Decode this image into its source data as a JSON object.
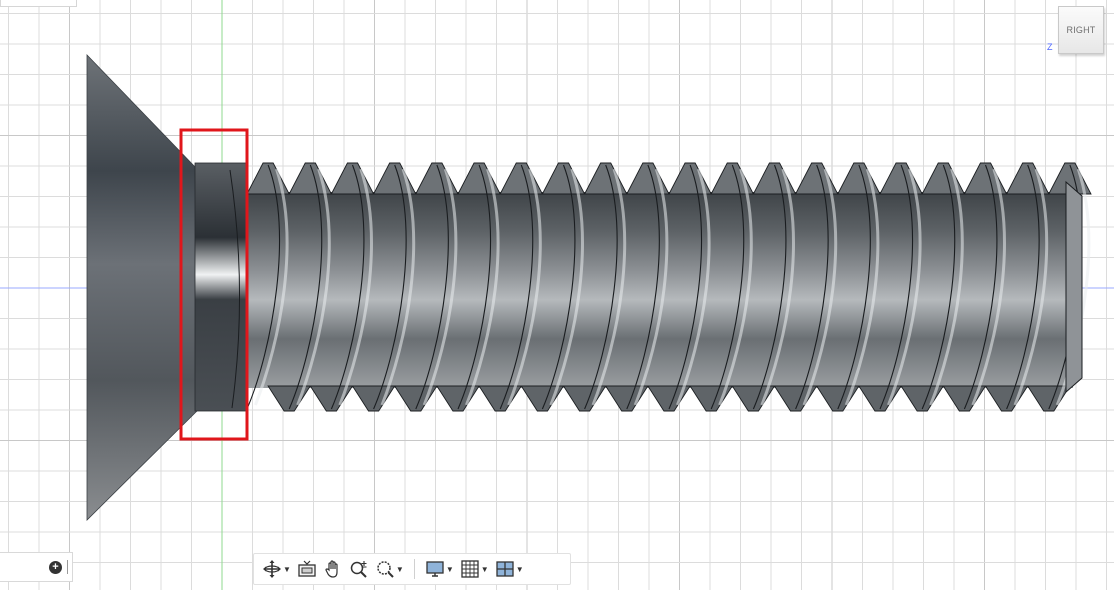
{
  "viewcube": {
    "face_label": "RIGHT",
    "axis_label": "Z"
  },
  "highlight": {
    "color": "#e0161b"
  },
  "colors": {
    "grid": "#dcdcdc",
    "grid_major": "#c8c8c8",
    "axis_green": "#8fd88f",
    "axis_blue": "#9aa8ff",
    "bolt_dark": "#2c3136",
    "bolt_light": "#e8eaec"
  },
  "browser_panel": {
    "icon": "plus-circle-icon"
  },
  "nav_toolbar": {
    "tools": [
      {
        "name": "orbit-tool",
        "icon": "orbit-icon",
        "has_menu": true
      },
      {
        "name": "look-at-tool",
        "icon": "look-at-icon",
        "has_menu": false
      },
      {
        "name": "pan-tool",
        "icon": "hand-icon",
        "has_menu": false
      },
      {
        "name": "zoom-tool",
        "icon": "zoom-plusminus-icon",
        "has_menu": false
      },
      {
        "name": "fit-tool",
        "icon": "zoom-window-icon",
        "has_menu": true
      },
      {
        "name": "display-settings",
        "icon": "monitor-icon",
        "has_menu": true
      },
      {
        "name": "grid-settings",
        "icon": "grid-icon",
        "has_menu": true
      },
      {
        "name": "viewports",
        "icon": "viewports-icon",
        "has_menu": true
      }
    ]
  }
}
